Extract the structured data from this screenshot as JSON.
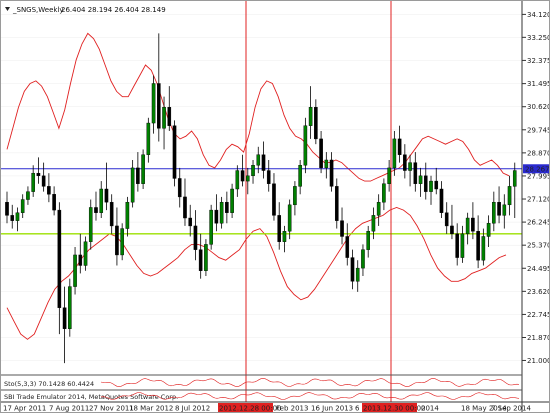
{
  "chart_header": {
    "symbol": "_SNGS,Weekly",
    "ohlc": "26.404 28.194 26.404 28.149"
  },
  "price_scale": {
    "ticks": [
      "34.120",
      "33.250",
      "32.375",
      "31.495",
      "30.620",
      "29.745",
      "28.870",
      "27.995",
      "27.120",
      "26.245",
      "25.370",
      "24.495",
      "23.620",
      "22.745",
      "21.870",
      "21.000"
    ],
    "current_price": "28.267"
  },
  "x_axis": {
    "labels": [
      "17 Apr 2011",
      "7 Aug 2011",
      "27 Nov 2011",
      "18 Mar 2012",
      "8 Jul 2012",
      "2012.12.28 00:00",
      "Feb 2013",
      "16 Jun 2013",
      "6",
      "2013.12.30 00:00",
      "2014",
      "18 May 2014",
      "7 Sep 2014"
    ]
  },
  "indicators": {
    "stochastic": "Sto(5,3,3) 70.1428 60.4424",
    "footer": "SBI Trade Emulator 2014, MetaQuotes Software Corp."
  },
  "colors": {
    "bull": "#008000",
    "bear": "#000000",
    "bands": "#e02020",
    "resistance": "#2a2ad0",
    "support": "#9be000",
    "vline": "#e02020",
    "price_tag": "#2a2ad0"
  },
  "chart_data": {
    "type": "candlestick",
    "ylim": [
      20.6,
      34.4
    ],
    "candles": [
      [
        27.0,
        27.4,
        26.2,
        26.5
      ],
      [
        26.5,
        26.9,
        26.0,
        26.3
      ],
      [
        26.3,
        26.8,
        25.9,
        26.6
      ],
      [
        26.6,
        27.3,
        26.4,
        27.1
      ],
      [
        27.1,
        27.6,
        26.9,
        27.4
      ],
      [
        27.4,
        28.4,
        27.2,
        28.1
      ],
      [
        28.1,
        28.7,
        27.7,
        28.0
      ],
      [
        28.0,
        28.5,
        27.4,
        27.6
      ],
      [
        27.6,
        28.1,
        27.0,
        27.3
      ],
      [
        27.3,
        27.6,
        26.5,
        26.7
      ],
      [
        26.7,
        27.0,
        22.0,
        23.0
      ],
      [
        23.0,
        23.8,
        20.9,
        22.2
      ],
      [
        22.2,
        24.1,
        21.9,
        23.8
      ],
      [
        23.8,
        25.3,
        23.5,
        25.0
      ],
      [
        25.0,
        25.8,
        24.3,
        24.6
      ],
      [
        24.6,
        25.7,
        24.4,
        25.5
      ],
      [
        25.5,
        27.1,
        25.2,
        26.8
      ],
      [
        26.8,
        27.4,
        26.3,
        26.6
      ],
      [
        26.6,
        27.8,
        26.4,
        27.5
      ],
      [
        27.5,
        28.5,
        26.7,
        27.0
      ],
      [
        27.0,
        27.3,
        25.8,
        26.1
      ],
      [
        26.1,
        26.8,
        24.6,
        25.0
      ],
      [
        25.0,
        26.2,
        24.8,
        26.0
      ],
      [
        26.0,
        27.2,
        25.7,
        27.0
      ],
      [
        27.0,
        28.6,
        26.8,
        28.3
      ],
      [
        28.3,
        28.9,
        27.4,
        27.7
      ],
      [
        27.7,
        29.0,
        27.5,
        28.8
      ],
      [
        28.8,
        30.2,
        28.5,
        30.0
      ],
      [
        30.0,
        31.8,
        29.6,
        31.5
      ],
      [
        31.5,
        33.4,
        29.3,
        29.8
      ],
      [
        29.8,
        31.0,
        29.0,
        30.6
      ],
      [
        30.6,
        31.4,
        29.7,
        29.9
      ],
      [
        29.9,
        30.1,
        27.6,
        27.9
      ],
      [
        27.9,
        28.3,
        26.8,
        27.2
      ],
      [
        27.2,
        27.9,
        26.1,
        26.4
      ],
      [
        26.4,
        26.9,
        25.7,
        26.1
      ],
      [
        26.1,
        26.7,
        24.8,
        25.2
      ],
      [
        25.2,
        25.8,
        24.1,
        24.4
      ],
      [
        24.4,
        25.6,
        24.2,
        25.4
      ],
      [
        25.4,
        26.9,
        25.2,
        26.7
      ],
      [
        26.7,
        27.3,
        25.9,
        26.2
      ],
      [
        26.2,
        27.2,
        26.0,
        27.0
      ],
      [
        27.0,
        27.4,
        26.2,
        26.6
      ],
      [
        26.6,
        27.7,
        26.4,
        27.5
      ],
      [
        27.5,
        28.4,
        27.2,
        28.2
      ],
      [
        28.2,
        28.8,
        27.6,
        27.8
      ],
      [
        27.8,
        28.3,
        27.3,
        28.0
      ],
      [
        28.0,
        28.6,
        27.7,
        28.4
      ],
      [
        28.4,
        29.1,
        28.1,
        28.8
      ],
      [
        28.8,
        29.3,
        27.9,
        28.2
      ],
      [
        28.2,
        28.6,
        27.4,
        27.7
      ],
      [
        27.7,
        28.1,
        26.3,
        26.5
      ],
      [
        26.5,
        27.0,
        25.2,
        25.5
      ],
      [
        25.5,
        26.1,
        25.1,
        25.9
      ],
      [
        25.9,
        27.1,
        25.6,
        26.9
      ],
      [
        26.9,
        27.8,
        26.5,
        27.6
      ],
      [
        27.6,
        28.6,
        27.3,
        28.4
      ],
      [
        28.4,
        30.2,
        28.1,
        29.9
      ],
      [
        29.9,
        31.4,
        29.4,
        30.6
      ],
      [
        30.6,
        30.9,
        29.2,
        29.4
      ],
      [
        29.4,
        29.7,
        28.1,
        28.3
      ],
      [
        28.3,
        28.9,
        27.9,
        28.6
      ],
      [
        28.6,
        28.9,
        27.4,
        27.6
      ],
      [
        27.6,
        27.9,
        26.0,
        26.3
      ],
      [
        26.3,
        26.8,
        25.4,
        25.7
      ],
      [
        25.7,
        26.2,
        24.6,
        24.9
      ],
      [
        24.9,
        25.2,
        23.7,
        24.0
      ],
      [
        24.0,
        24.8,
        23.6,
        24.5
      ],
      [
        24.5,
        25.4,
        24.2,
        25.2
      ],
      [
        25.2,
        26.1,
        24.9,
        25.9
      ],
      [
        25.9,
        26.8,
        25.6,
        26.5
      ],
      [
        26.5,
        27.3,
        26.1,
        27.0
      ],
      [
        27.0,
        27.9,
        26.7,
        27.7
      ],
      [
        27.7,
        28.6,
        27.4,
        28.3
      ],
      [
        28.3,
        29.7,
        28.0,
        29.4
      ],
      [
        29.4,
        29.9,
        28.5,
        28.8
      ],
      [
        28.8,
        29.2,
        27.9,
        28.2
      ],
      [
        28.2,
        28.8,
        27.6,
        28.5
      ],
      [
        28.5,
        28.9,
        27.4,
        27.7
      ],
      [
        27.7,
        28.3,
        27.2,
        28.0
      ],
      [
        28.0,
        28.5,
        27.1,
        27.4
      ],
      [
        27.4,
        28.0,
        26.9,
        27.8
      ],
      [
        27.8,
        28.3,
        27.3,
        27.5
      ],
      [
        27.5,
        27.8,
        26.4,
        26.6
      ],
      [
        26.6,
        27.0,
        25.8,
        26.1
      ],
      [
        26.1,
        26.9,
        25.6,
        25.8
      ],
      [
        25.8,
        26.2,
        24.6,
        24.9
      ],
      [
        24.9,
        26.1,
        24.7,
        25.8
      ],
      [
        25.8,
        26.6,
        25.4,
        26.4
      ],
      [
        26.4,
        27.0,
        25.6,
        25.9
      ],
      [
        25.9,
        26.5,
        24.5,
        24.8
      ],
      [
        24.8,
        26.0,
        24.6,
        25.7
      ],
      [
        25.7,
        26.5,
        25.3,
        26.2
      ],
      [
        26.2,
        27.4,
        25.9,
        27.0
      ],
      [
        27.0,
        27.6,
        26.2,
        26.5
      ],
      [
        26.5,
        27.3,
        26.0,
        26.9
      ],
      [
        26.9,
        28.0,
        26.5,
        27.6
      ],
      [
        27.6,
        28.5,
        26.4,
        28.2
      ]
    ],
    "upper_band": [
      29.0,
      29.8,
      30.6,
      31.2,
      31.5,
      31.6,
      31.4,
      31.0,
      30.4,
      29.8,
      30.5,
      31.5,
      32.4,
      33.0,
      33.4,
      33.2,
      32.8,
      32.2,
      31.6,
      31.2,
      31.0,
      31.0,
      31.4,
      31.8,
      32.2,
      32.0,
      31.5,
      30.8,
      30.1,
      29.6,
      29.4,
      29.5,
      29.7,
      29.4,
      28.8,
      28.4,
      28.3,
      28.6,
      29.0,
      29.2,
      29.1,
      28.9,
      29.6,
      30.6,
      31.3,
      31.6,
      31.5,
      31.0,
      30.3,
      29.8,
      29.5,
      29.4,
      29.2,
      28.9,
      28.7,
      28.5,
      28.5,
      28.6,
      28.5,
      28.3,
      28.1,
      27.9,
      27.8,
      27.8,
      27.9,
      28.0,
      28.1,
      28.2,
      28.3,
      28.5,
      28.8,
      29.1,
      29.4,
      29.5,
      29.4,
      29.3,
      29.2,
      29.3,
      29.4,
      29.3,
      29.0,
      28.6,
      28.4,
      28.5,
      28.6,
      28.4,
      28.1,
      28.0
    ],
    "lower_band": [
      23.0,
      22.5,
      22.0,
      21.8,
      22.0,
      22.6,
      23.2,
      23.7,
      24.0,
      24.2,
      24.5,
      24.9,
      25.2,
      25.4,
      25.6,
      25.8,
      25.7,
      25.4,
      25.0,
      24.6,
      24.3,
      24.2,
      24.3,
      24.5,
      24.7,
      24.9,
      25.2,
      25.4,
      25.4,
      25.3,
      25.1,
      24.9,
      24.8,
      25.0,
      25.2,
      25.6,
      25.9,
      26.0,
      25.7,
      25.1,
      24.4,
      23.8,
      23.5,
      23.3,
      23.4,
      23.7,
      24.1,
      24.5,
      24.9,
      25.3,
      25.7,
      26.0,
      26.2,
      26.3,
      26.4,
      26.5,
      26.7,
      26.8,
      26.7,
      26.5,
      26.1,
      25.6,
      25.0,
      24.5,
      24.2,
      24.0,
      24.0,
      24.1,
      24.3,
      24.4,
      24.5,
      24.7,
      24.9,
      25.0
    ]
  }
}
